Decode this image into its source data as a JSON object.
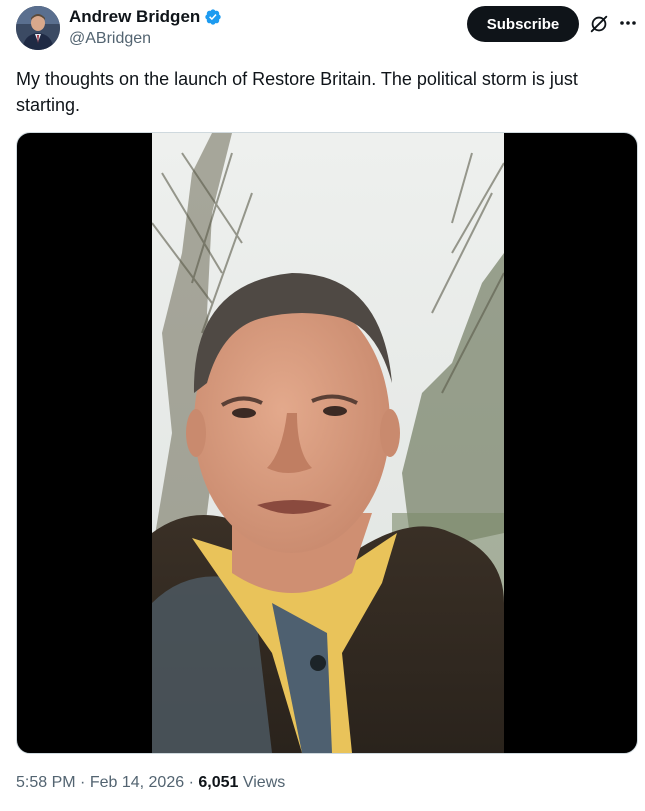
{
  "author": {
    "display_name": "Andrew Bridgen",
    "handle": "@ABridgen",
    "verified": true,
    "verified_color": "#1d9bf0"
  },
  "actions": {
    "subscribe_label": "Subscribe",
    "grok_icon": "grok-icon",
    "more_icon": "more-dots-icon"
  },
  "tweet": {
    "text": "My thoughts on the launch of Restore Britain. The political storm is just starting."
  },
  "media": {
    "type": "video"
  },
  "meta": {
    "time": "5:58 PM",
    "separator": "·",
    "date": "Feb 14, 2026",
    "views_count": "6,051",
    "views_label": "Views"
  },
  "colors": {
    "text_primary": "#0f1419",
    "text_secondary": "#536471",
    "button_bg": "#0f1419"
  }
}
